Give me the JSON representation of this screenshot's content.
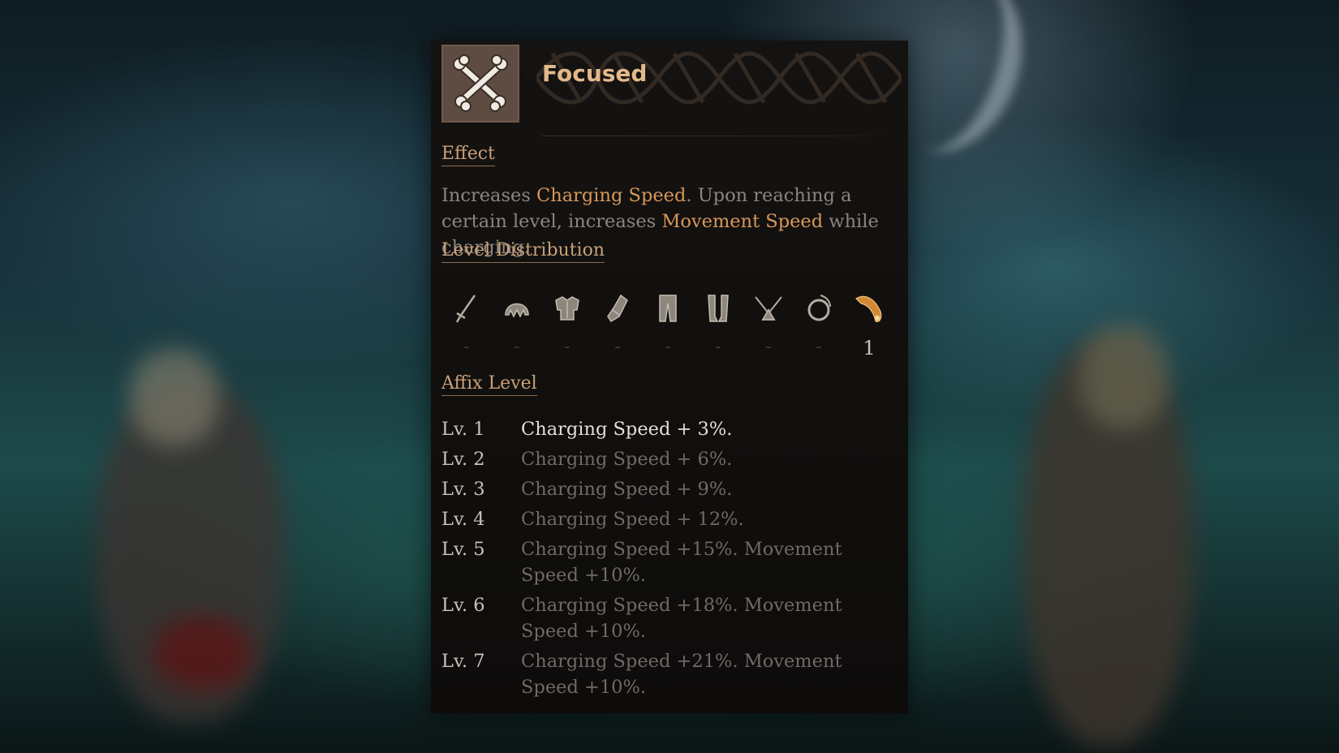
{
  "skill": {
    "title": "Focused",
    "icon": "crossed-bones-icon"
  },
  "effect": {
    "label": "Effect",
    "text_parts": [
      "Increases ",
      "Charging Speed",
      ". Upon reaching a certain level, increases ",
      "Movement Speed",
      " while charging."
    ]
  },
  "level_distribution": {
    "label": "Level Distribution",
    "slots": [
      {
        "icon": "weapon-icon",
        "value": "-"
      },
      {
        "icon": "helmet-icon",
        "value": "-"
      },
      {
        "icon": "chest-armor-icon",
        "value": "-"
      },
      {
        "icon": "gloves-icon",
        "value": "-"
      },
      {
        "icon": "pants-icon",
        "value": "-"
      },
      {
        "icon": "boots-icon",
        "value": "-"
      },
      {
        "icon": "amulet-icon",
        "value": "-"
      },
      {
        "icon": "ring-icon",
        "value": "-"
      },
      {
        "icon": "horn-icon",
        "value": "1"
      }
    ]
  },
  "affix": {
    "label": "Affix Level",
    "levels": [
      {
        "lv": "Lv. 1",
        "desc": "Charging Speed + 3%."
      },
      {
        "lv": "Lv. 2",
        "desc": "Charging Speed + 6%."
      },
      {
        "lv": "Lv. 3",
        "desc": "Charging Speed + 9%."
      },
      {
        "lv": "Lv. 4",
        "desc": "Charging Speed + 12%."
      },
      {
        "lv": "Lv. 5",
        "desc": "Charging Speed +15%. Movement Speed +10%."
      },
      {
        "lv": "Lv. 6",
        "desc": "Charging Speed +18%. Movement Speed +10%."
      },
      {
        "lv": "Lv. 7",
        "desc": "Charging Speed +21%. Movement Speed +10%."
      }
    ]
  },
  "colors": {
    "accent_orange": "#d7975a",
    "title_gold": "#e3b98a",
    "section_label": "#c9a079",
    "active_slot": "#d08a35"
  }
}
